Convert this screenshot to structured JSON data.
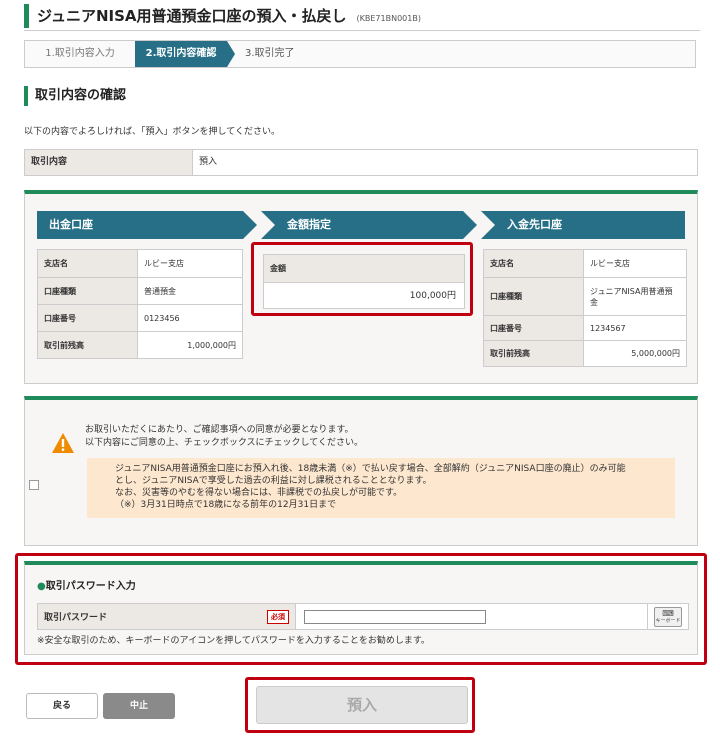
{
  "header": {
    "title": "ジュニアNISA用普通預金口座の預入・払戻し",
    "code": "(KBE71BN001B)"
  },
  "steps": [
    "1.取引内容入力",
    "2.取引内容確認",
    "3.取引完了"
  ],
  "section_title": "取引内容の確認",
  "intro": "以下の内容でよろしければ、「預入」ボタンを押してください。",
  "transaction": {
    "label": "取引内容",
    "value": "預入"
  },
  "from_account": {
    "header": "出金口座",
    "rows": [
      {
        "label": "支店名",
        "value": "ルビー支店"
      },
      {
        "label": "口座種類",
        "value": "普通預金"
      },
      {
        "label": "口座番号",
        "value": "0123456"
      },
      {
        "label": "取引前残高",
        "value": "1,000,000円"
      }
    ]
  },
  "amount": {
    "header": "金額指定",
    "label": "金額",
    "value": "100,000円"
  },
  "to_account": {
    "header": "入金先口座",
    "rows": [
      {
        "label": "支店名",
        "value": "ルビー支店"
      },
      {
        "label": "口座種類",
        "value": "ジュニアNISA用普通預金"
      },
      {
        "label": "口座番号",
        "value": "1234567"
      },
      {
        "label": "取引前残高",
        "value": "5,000,000円"
      }
    ]
  },
  "notice": {
    "line1": "お取引いただくにあたり、ご確認事項への同意が必要となります。",
    "line2": "以下内容にご同意の上、チェックボックスにチェックしてください。",
    "agree_lines": [
      "ジュニアNISA用普通預金口座にお預入れ後、18歳未満（※）で払い戻す場合、全部解約（ジュニアNISA口座の廃止）のみ可能",
      "とし、ジュニアNISAで享受した過去の利益に対し課税されることとなります。",
      "なお、災害等のやむを得ない場合には、非課税での払戻しが可能です。",
      "（※）3月31日時点で18歳になる前年の12月31日まで"
    ]
  },
  "password": {
    "title": "取引パスワード入力",
    "label": "取引パスワード",
    "required": "必須",
    "keyboard_label": "キーボード",
    "note": "※安全な取引のため、キーボードのアイコンを押してパスワードを入力することをお勧めします。"
  },
  "buttons": {
    "back": "戻る",
    "stop": "中止",
    "deposit": "預入"
  },
  "colors": {
    "accent_green": "#1f8a5a",
    "step_blue": "#266f87",
    "highlight_red": "#c00010"
  }
}
